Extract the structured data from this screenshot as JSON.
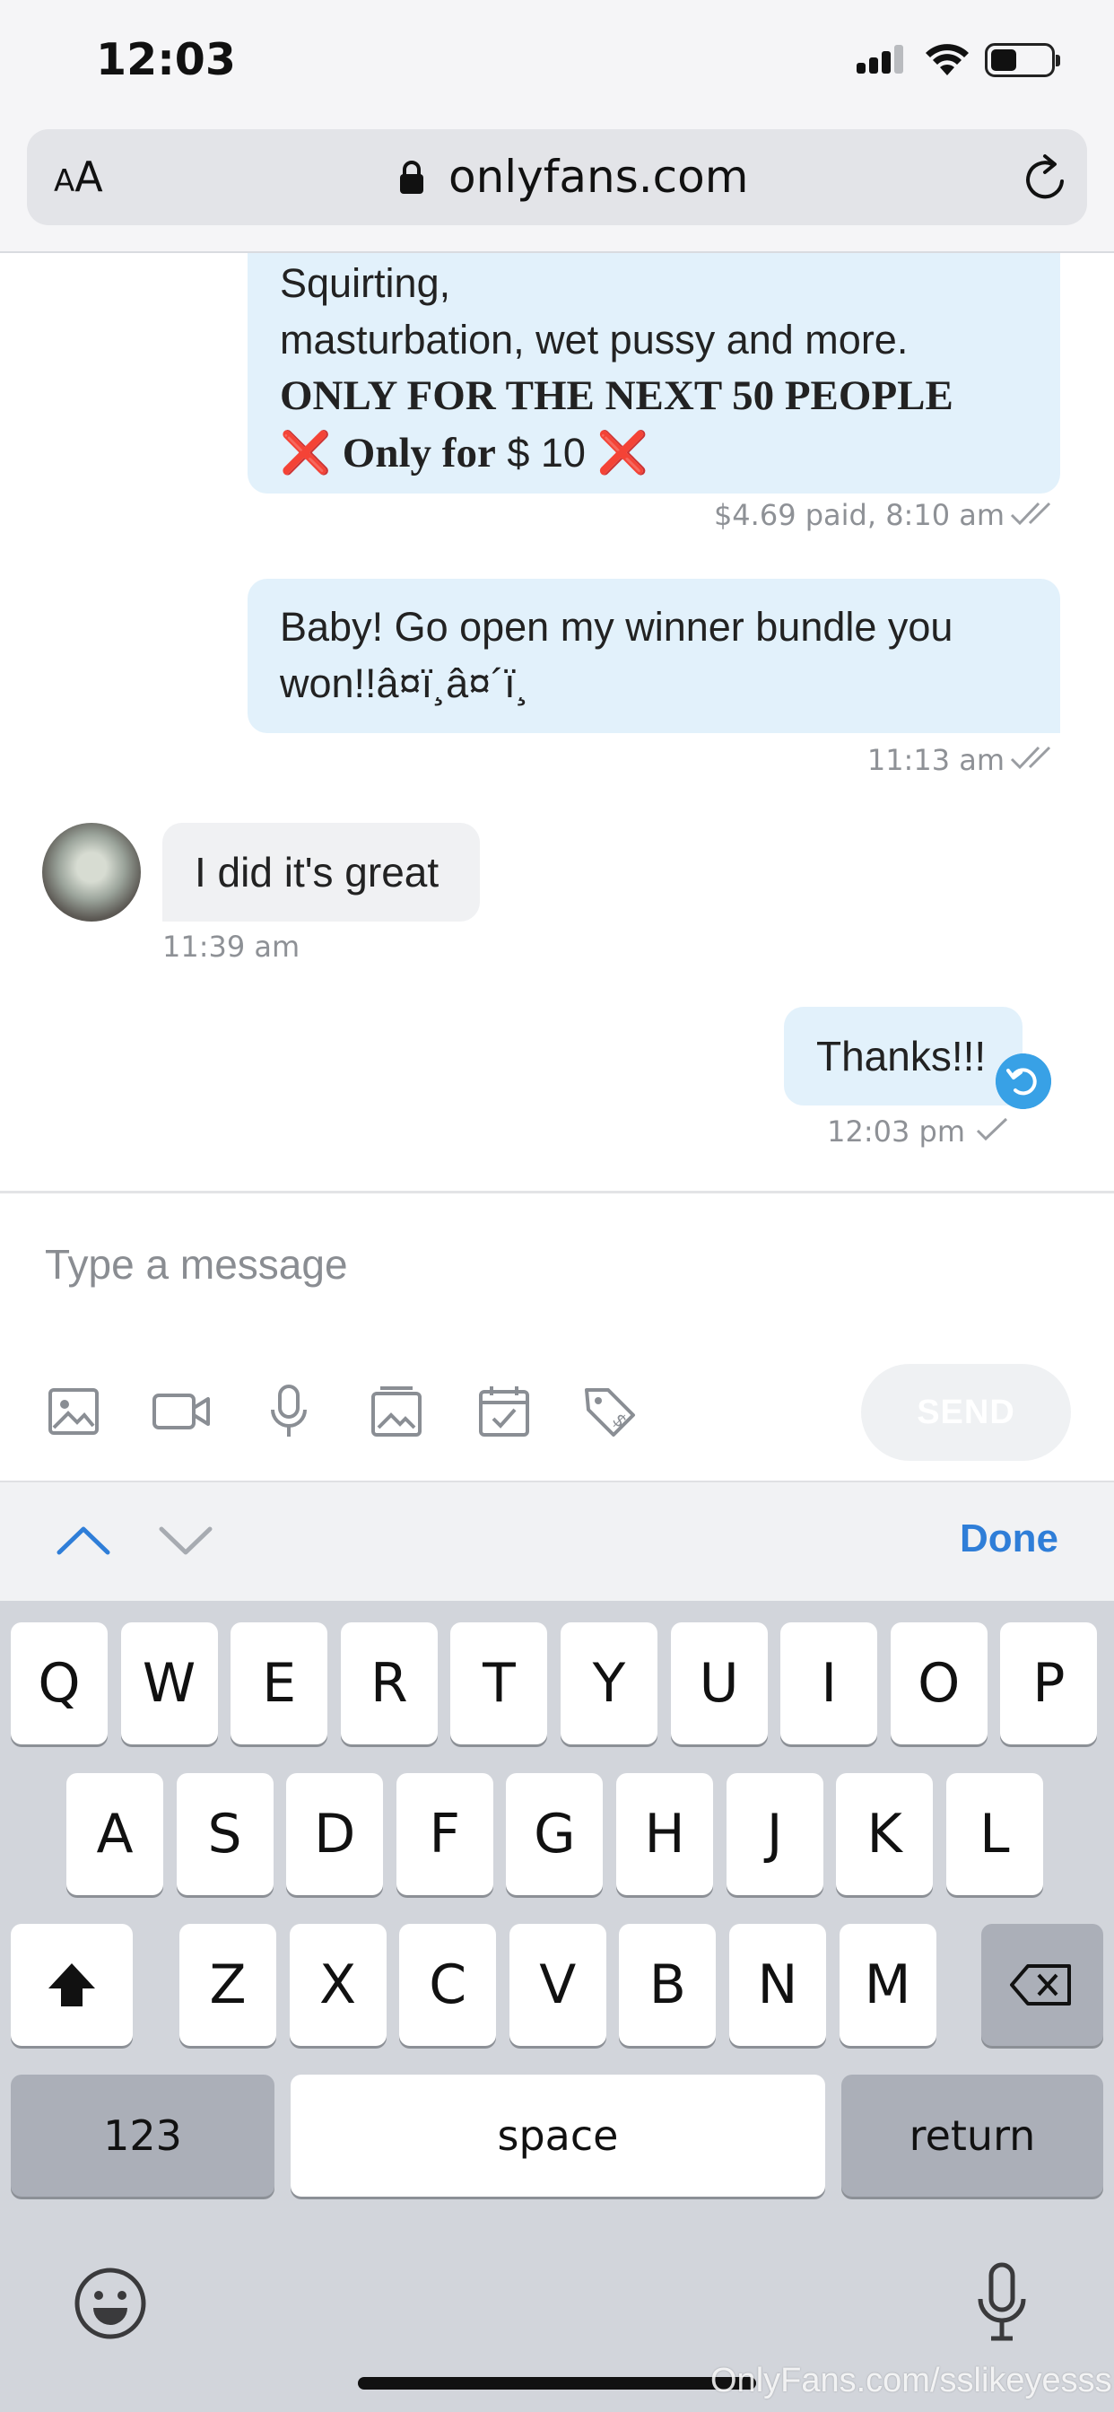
{
  "status_bar": {
    "time": "12:03"
  },
  "browser": {
    "text_size_label_small": "A",
    "text_size_label_large": "A",
    "url": "onlyfans.com"
  },
  "messages": [
    {
      "direction": "outgoing",
      "line1": "Squirting,",
      "line2": "masturbation, wet pussy and more.",
      "line3": "ONLY FOR THE NEXT 50 PEOPLE",
      "line4_mark_left": "❌",
      "line4_bold": "Only for",
      "line4_text": "$ 10",
      "line4_mark_right": "❌",
      "meta": "$4.69 paid, 8:10 am"
    },
    {
      "direction": "outgoing",
      "line1": "Baby! Go open my winner bundle you",
      "line2": "won!!â¤ï¸â¤´ï¸",
      "meta": "11:13 am"
    },
    {
      "direction": "incoming",
      "text": "I did it's great",
      "meta": "11:39 am"
    },
    {
      "direction": "outgoing",
      "text": "Thanks!!!",
      "meta": "12:03 pm"
    }
  ],
  "composer": {
    "placeholder": "Type a message",
    "send_label": "SEND",
    "tools": [
      "image-icon",
      "video-icon",
      "microphone-icon",
      "vault-icon",
      "calendar-icon",
      "price-tag-icon"
    ]
  },
  "keyboard_accessory": {
    "done_label": "Done"
  },
  "keyboard": {
    "row1": [
      "Q",
      "W",
      "E",
      "R",
      "T",
      "Y",
      "U",
      "I",
      "O",
      "P"
    ],
    "row2": [
      "A",
      "S",
      "D",
      "F",
      "G",
      "H",
      "J",
      "K",
      "L"
    ],
    "row3": [
      "Z",
      "X",
      "C",
      "V",
      "B",
      "N",
      "M"
    ],
    "numbers_label": "123",
    "space_label": "space",
    "return_label": "return"
  },
  "watermark": "OnlyFans.com/sslikeyesss",
  "colors": {
    "accent": "#2f7ed8",
    "outgoing_bubble": "#e2f1fb",
    "incoming_bubble": "#f0f1f3",
    "undo": "#38a1e6"
  }
}
